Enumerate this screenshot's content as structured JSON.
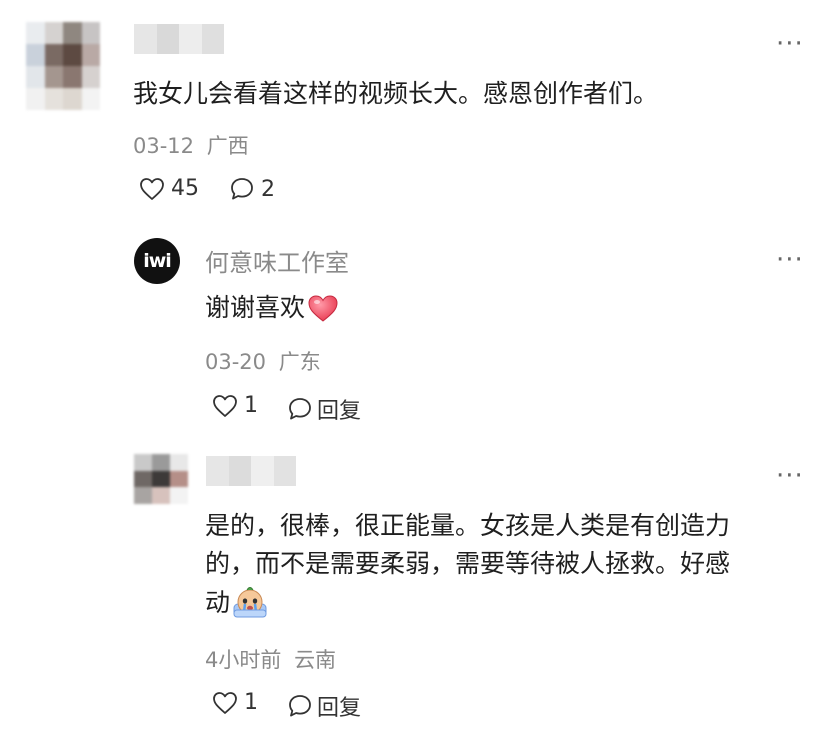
{
  "comment1": {
    "text": "我女儿会看着这样的视频长大。感恩创作者们。",
    "date": "03-12",
    "location": "广西",
    "likes": "45",
    "replies": "2"
  },
  "reply1": {
    "author": "何意味工作室",
    "avatar_text": "iwi",
    "text": "谢谢喜欢",
    "emoji": "heart-emoji",
    "date": "03-20",
    "location": "广东",
    "likes": "1",
    "reply_label": "回复"
  },
  "reply2": {
    "text_line1": "是的，很棒，很正能量。女孩是人类是有创造力",
    "text_line2": "的，而不是需要柔弱，需要等待被人拯救。好感",
    "text_line3": "动",
    "emoji": "crying-face-emoji",
    "date": "4小时前",
    "location": "云南",
    "likes": "1",
    "reply_label": "回复"
  },
  "more_label": "···"
}
